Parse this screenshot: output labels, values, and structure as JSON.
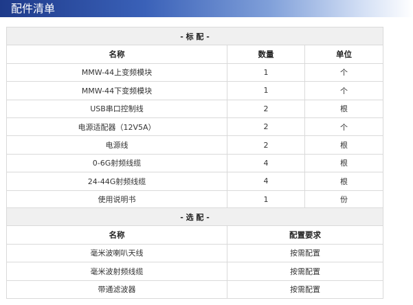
{
  "page": {
    "title": "配件清单"
  },
  "standard": {
    "section_label": "- 标 配 -",
    "headers": [
      "名称",
      "数量",
      "单位"
    ],
    "rows": [
      [
        "MMW-44上变频模块",
        "1",
        "个"
      ],
      [
        "MMW-44下变频模块",
        "1",
        "个"
      ],
      [
        "USB串口控制线",
        "2",
        "根"
      ],
      [
        "电源适配器（12V5A）",
        "2",
        "个"
      ],
      [
        "电源线",
        "2",
        "根"
      ],
      [
        "0-6G射频线缆",
        "4",
        "根"
      ],
      [
        "24-44G射频线缆",
        "4",
        "根"
      ],
      [
        "使用说明书",
        "1",
        "份"
      ]
    ]
  },
  "optional": {
    "section_label": "- 选 配 -",
    "headers": [
      "名称",
      "配置要求"
    ],
    "rows": [
      [
        "毫米波喇叭天线",
        "按需配置"
      ],
      [
        "毫米波射频线缆",
        "按需配置"
      ],
      [
        "带通滤波器",
        "按需配置"
      ]
    ]
  }
}
